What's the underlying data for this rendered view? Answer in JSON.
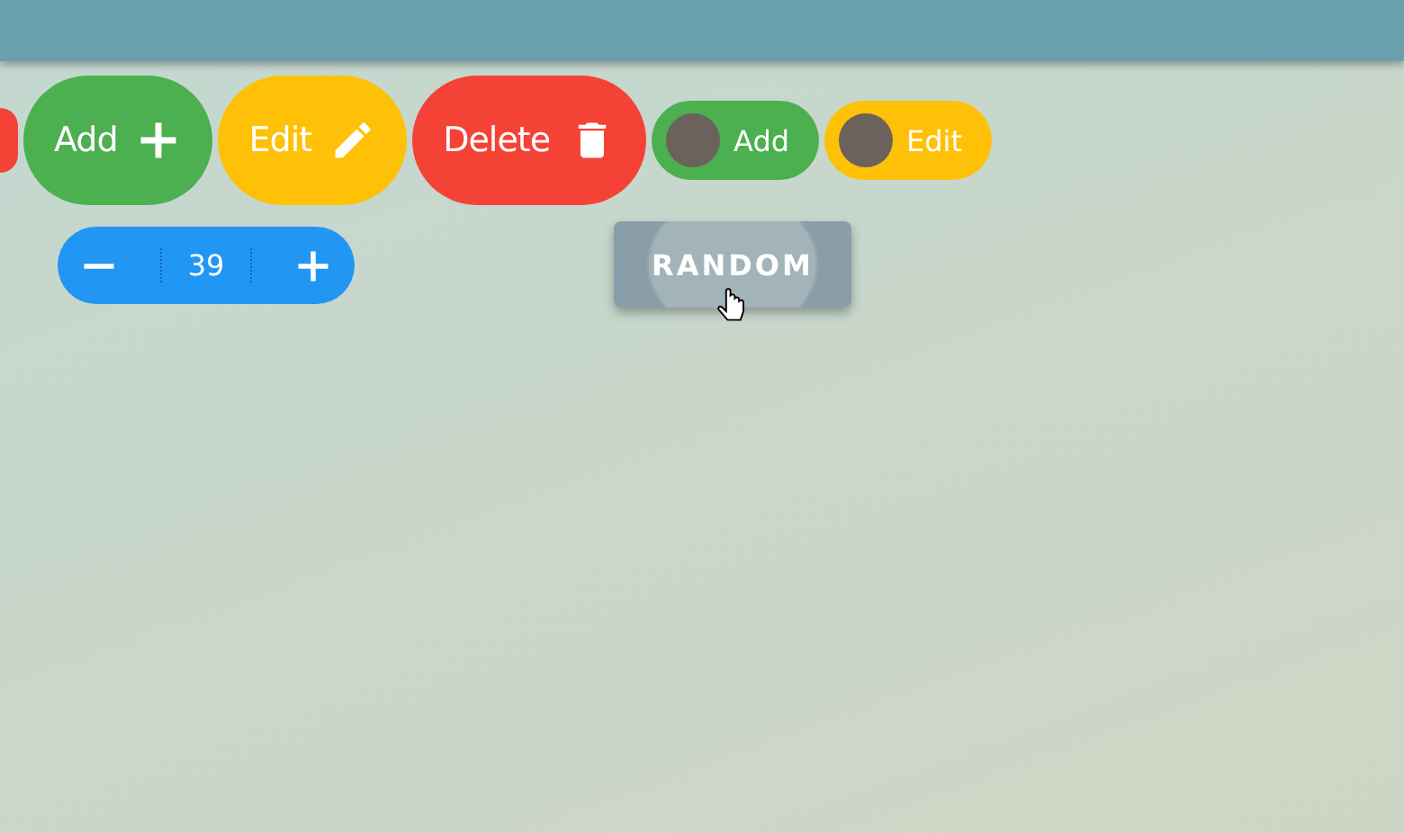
{
  "buttons": [
    {
      "kind": "add",
      "label": "Add",
      "color": "#4caf50"
    },
    {
      "kind": "edit",
      "label": "Edit",
      "color": "#ffc107"
    },
    {
      "kind": "delete",
      "label": "Delete",
      "color": "#f44336"
    },
    {
      "kind": "avatar",
      "label": "Add",
      "color": "#4caf50"
    },
    {
      "kind": "avatar",
      "label": "Edit",
      "color": "#ffc107"
    }
  ],
  "stepper": {
    "value": "39"
  },
  "random_button": {
    "label": "RANDOM"
  }
}
